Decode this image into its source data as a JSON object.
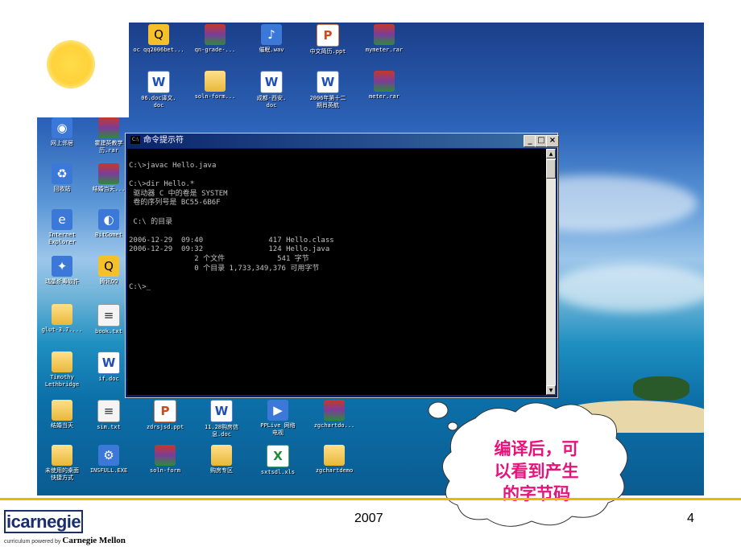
{
  "desktop": {
    "icons": [
      {
        "label": "oc qq2006bet...",
        "icon": "qq-icon"
      },
      {
        "label": "qn-grade-...",
        "icon": "winrar-icon"
      },
      {
        "label": "催眠.wav",
        "icon": "audio-icon"
      },
      {
        "label": "中文简历.ppt",
        "icon": "ppt-icon"
      },
      {
        "label": "mymeter.rar",
        "icon": "winrar-icon"
      },
      {
        "label": "06.doc译文.\ndoc",
        "icon": "doc-icon"
      },
      {
        "label": "soln-form...",
        "icon": "folder-icon"
      },
      {
        "label": "成都-西安.\ndoc",
        "icon": "doc-icon"
      },
      {
        "label": "2006年第十二\n期肖英航",
        "icon": "doc-icon"
      },
      {
        "label": "meter.rar",
        "icon": "winrar-icon"
      },
      {
        "label": "网上邻居",
        "icon": "network-icon"
      },
      {
        "label": "霍建英教学\n历.rar",
        "icon": "winrar-icon"
      },
      {
        "label": "回收站",
        "icon": "recycle-bin-icon"
      },
      {
        "label": "结婚当天...",
        "icon": "winrar-icon"
      },
      {
        "label": "Internet\nExplorer",
        "icon": "ie-icon"
      },
      {
        "label": "BitComet",
        "icon": "bitcomet-icon"
      },
      {
        "label": "瑞星杀毒软件",
        "icon": "antivirus-icon"
      },
      {
        "label": "腾讯QQ",
        "icon": "qq-icon"
      },
      {
        "label": "glut-3.7....",
        "icon": "folder-icon"
      },
      {
        "label": "book.txt",
        "icon": "txt-icon"
      },
      {
        "label": "Timothy\nLethbridge",
        "icon": "folder-icon"
      },
      {
        "label": "if.doc",
        "icon": "doc-icon"
      },
      {
        "label": "结婚当天",
        "icon": "folder-icon"
      },
      {
        "label": "sim.txt",
        "icon": "txt-icon"
      },
      {
        "label": "zdrsjsd.ppt",
        "icon": "ppt-icon"
      },
      {
        "label": "11.28购房信\n息.doc",
        "icon": "doc-icon"
      },
      {
        "label": "PPLive 网络\n电视",
        "icon": "pplive-icon"
      },
      {
        "label": "zgchartdo...",
        "icon": "winrar-icon"
      },
      {
        "label": "未使用的桌面\n快捷方式",
        "icon": "folder-icon"
      },
      {
        "label": "INSFULL.EXE",
        "icon": "installer-icon"
      },
      {
        "label": "soln-form",
        "icon": "winrar-icon"
      },
      {
        "label": "购房专区",
        "icon": "folder-icon"
      },
      {
        "label": "sxtsdl.xls",
        "icon": "xls-icon"
      },
      {
        "label": "zgchartdemo",
        "icon": "folder-icon"
      }
    ]
  },
  "cmd_window": {
    "title": "命令提示符",
    "icon_text": "C:\\",
    "buttons": {
      "minimize": "_",
      "maximize": "□",
      "close": "×"
    },
    "lines": [
      "C:\\>javac Hello.java",
      "",
      "C:\\>dir Hello.*",
      " 驱动器 C 中的卷是 SYSTEM",
      " 卷的序列号是 BC55-6B6F",
      "",
      " C:\\ 的目录",
      "",
      "2006-12-29  09:40               417 Hello.class",
      "2006-12-29  09:32               124 Hello.java",
      "               2 个文件            541 字节",
      "               0 个目录 1,733,349,376 可用字节",
      "",
      "C:\\>_"
    ]
  },
  "callout": {
    "text_line1": "编译后，可",
    "text_line2": "以看到产生",
    "text_line3": "的字节码",
    "color": "#e8127a"
  },
  "footer": {
    "year": "2007",
    "page": "4",
    "logo_word": "icarnegie",
    "logo_tag": "curriculum powered by",
    "logo_tag_brand": "Carnegie Mellon",
    "rule_color": "#f2b400"
  }
}
